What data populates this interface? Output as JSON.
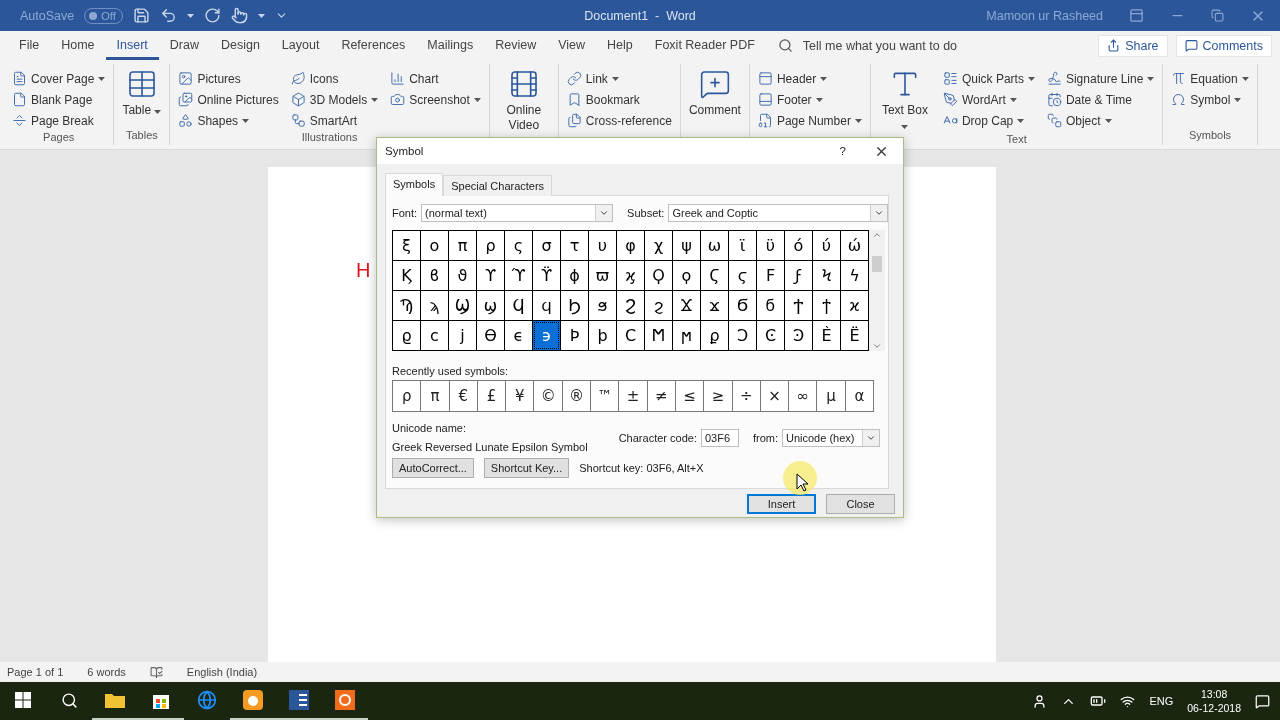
{
  "title_bar": {
    "autosave": {
      "label": "AutoSave",
      "on": false,
      "toggle_text": "Off"
    },
    "title": "Document1  -  Word",
    "user": "Mamoon ur Rasheed"
  },
  "ribbon_tabs": [
    {
      "label": "File",
      "selected": false
    },
    {
      "label": "Home",
      "selected": false
    },
    {
      "label": "Insert",
      "selected": true
    },
    {
      "label": "Draw",
      "selected": false
    },
    {
      "label": "Design",
      "selected": false
    },
    {
      "label": "Layout",
      "selected": false
    },
    {
      "label": "References",
      "selected": false
    },
    {
      "label": "Mailings",
      "selected": false
    },
    {
      "label": "Review",
      "selected": false
    },
    {
      "label": "View",
      "selected": false
    },
    {
      "label": "Help",
      "selected": false
    },
    {
      "label": "Foxit Reader PDF",
      "selected": false
    }
  ],
  "tell_me": {
    "placeholder": "Tell me what you want to do"
  },
  "share_button": "Share",
  "comments_button": "Comments",
  "ribbon_groups": [
    {
      "label": "Pages",
      "columns": [
        {
          "kind": "stack",
          "items": [
            {
              "label": "Cover Page",
              "dropdown": true
            },
            {
              "label": "Blank Page",
              "dropdown": false
            },
            {
              "label": "Page Break",
              "dropdown": false
            }
          ]
        }
      ]
    },
    {
      "label": "Tables",
      "columns": [
        {
          "kind": "large",
          "items": [
            {
              "label": "Table",
              "dropdown": true
            }
          ]
        }
      ]
    },
    {
      "label": "Illustrations",
      "columns": [
        {
          "kind": "stack",
          "items": [
            {
              "label": "Pictures",
              "dropdown": false
            },
            {
              "label": "Online Pictures",
              "dropdown": false
            },
            {
              "label": "Shapes",
              "dropdown": true
            }
          ]
        },
        {
          "kind": "stack",
          "items": [
            {
              "label": "Icons",
              "dropdown": false
            },
            {
              "label": "3D Models",
              "dropdown": true
            },
            {
              "label": "SmartArt",
              "dropdown": false
            }
          ]
        },
        {
          "kind": "stack",
          "items": [
            {
              "label": "Chart",
              "dropdown": false
            },
            {
              "label": "Screenshot",
              "dropdown": true
            }
          ]
        }
      ]
    },
    {
      "columns": [
        {
          "kind": "large",
          "items": [
            {
              "label": "Online Video",
              "dropdown": false
            }
          ]
        }
      ]
    },
    {
      "columns": [
        {
          "kind": "stack",
          "items": [
            {
              "label": "Link",
              "dropdown": true
            },
            {
              "label": "Bookmark",
              "dropdown": false
            },
            {
              "label": "Cross-reference",
              "dropdown": false
            }
          ]
        }
      ]
    },
    {
      "columns": [
        {
          "kind": "large",
          "items": [
            {
              "label": "Comment",
              "dropdown": false
            }
          ]
        }
      ]
    },
    {
      "columns": [
        {
          "kind": "stack",
          "items": [
            {
              "label": "Header",
              "dropdown": true
            },
            {
              "label": "Footer",
              "dropdown": true
            },
            {
              "label": "Page Number",
              "dropdown": true
            }
          ]
        }
      ]
    },
    {
      "label": "Text",
      "columns": [
        {
          "kind": "large",
          "items": [
            {
              "label": "Text Box",
              "dropdown": true
            }
          ]
        },
        {
          "kind": "stack",
          "items": [
            {
              "label": "Quick Parts",
              "dropdown": true
            },
            {
              "label": "WordArt",
              "dropdown": true
            },
            {
              "label": "Drop Cap",
              "dropdown": true
            }
          ]
        },
        {
          "kind": "stack",
          "items": [
            {
              "label": "Signature Line",
              "dropdown": true
            },
            {
              "label": "Date & Time",
              "dropdown": false
            },
            {
              "label": "Object",
              "dropdown": true
            }
          ]
        }
      ]
    },
    {
      "label": "Symbols",
      "columns": [
        {
          "kind": "stack",
          "items": [
            {
              "label": "Equation",
              "dropdown": true
            },
            {
              "label": "Symbol",
              "dropdown": true
            }
          ]
        }
      ]
    }
  ],
  "document": {
    "text": "H"
  },
  "symbol_dialog": {
    "title": "Symbol",
    "help": "?",
    "tabs": [
      {
        "label": "Symbols",
        "selected": true
      },
      {
        "label": "Special Characters",
        "selected": false
      }
    ],
    "font": {
      "label": "Font:",
      "value": "(normal text)"
    },
    "subset": {
      "label": "Subset:",
      "value": "Greek and Coptic"
    },
    "grid": [
      [
        {
          "char": "ξ",
          "selected": false
        },
        {
          "char": "ο",
          "selected": false
        },
        {
          "char": "π",
          "selected": false
        },
        {
          "char": "ρ",
          "selected": false
        },
        {
          "char": "ς",
          "selected": false
        },
        {
          "char": "σ",
          "selected": false
        },
        {
          "char": "τ",
          "selected": false
        },
        {
          "char": "υ",
          "selected": false
        },
        {
          "char": "φ",
          "selected": false
        },
        {
          "char": "χ",
          "selected": false
        },
        {
          "char": "ψ",
          "selected": false
        },
        {
          "char": "ω",
          "selected": false
        },
        {
          "char": "ϊ",
          "selected": false
        },
        {
          "char": "ϋ",
          "selected": false
        },
        {
          "char": "ό",
          "selected": false
        },
        {
          "char": "ύ",
          "selected": false
        },
        {
          "char": "ώ",
          "selected": false
        }
      ],
      [
        {
          "char": "Ϗ",
          "selected": false
        },
        {
          "char": "ϐ",
          "selected": false
        },
        {
          "char": "ϑ",
          "selected": false
        },
        {
          "char": "ϒ",
          "selected": false
        },
        {
          "char": "ϓ",
          "selected": false
        },
        {
          "char": "ϔ",
          "selected": false
        },
        {
          "char": "ϕ",
          "selected": false
        },
        {
          "char": "ϖ",
          "selected": false
        },
        {
          "char": "ϗ",
          "selected": false
        },
        {
          "char": "Ϙ",
          "selected": false
        },
        {
          "char": "ϙ",
          "selected": false
        },
        {
          "char": "Ϛ",
          "selected": false
        },
        {
          "char": "ϛ",
          "selected": false
        },
        {
          "char": "Ϝ",
          "selected": false
        },
        {
          "char": "ϝ",
          "selected": false
        },
        {
          "char": "Ϟ",
          "selected": false
        },
        {
          "char": "ϟ",
          "selected": false
        }
      ],
      [
        {
          "char": "Ϡ",
          "selected": false
        },
        {
          "char": "ϡ",
          "selected": false
        },
        {
          "char": "Ϣ",
          "selected": false
        },
        {
          "char": "ϣ",
          "selected": false
        },
        {
          "char": "Ϥ",
          "selected": false
        },
        {
          "char": "ϥ",
          "selected": false
        },
        {
          "char": "Ϧ",
          "selected": false
        },
        {
          "char": "ϧ",
          "selected": false
        },
        {
          "char": "Ϩ",
          "selected": false
        },
        {
          "char": "ϩ",
          "selected": false
        },
        {
          "char": "Ϫ",
          "selected": false
        },
        {
          "char": "ϫ",
          "selected": false
        },
        {
          "char": "Ϭ",
          "selected": false
        },
        {
          "char": "ϭ",
          "selected": false
        },
        {
          "char": "Ϯ",
          "selected": false
        },
        {
          "char": "ϯ",
          "selected": false
        },
        {
          "char": "ϰ",
          "selected": false
        }
      ],
      [
        {
          "char": "ϱ",
          "selected": false
        },
        {
          "char": "ϲ",
          "selected": false
        },
        {
          "char": "ϳ",
          "selected": false
        },
        {
          "char": "ϴ",
          "selected": false
        },
        {
          "char": "ϵ",
          "selected": false
        },
        {
          "char": "϶",
          "selected": true
        },
        {
          "char": "Ϸ",
          "selected": false
        },
        {
          "char": "ϸ",
          "selected": false
        },
        {
          "char": "Ϲ",
          "selected": false
        },
        {
          "char": "Ϻ",
          "selected": false
        },
        {
          "char": "ϻ",
          "selected": false
        },
        {
          "char": "ϼ",
          "selected": false
        },
        {
          "char": "Ͻ",
          "selected": false
        },
        {
          "char": "Ͼ",
          "selected": false
        },
        {
          "char": "Ͽ",
          "selected": false
        },
        {
          "char": "Ѐ",
          "selected": false
        },
        {
          "char": "Ё",
          "selected": false
        }
      ]
    ],
    "recent_label": "Recently used symbols:",
    "recent": [
      "ρ",
      "π",
      "€",
      "£",
      "¥",
      "©",
      "®",
      "™",
      "±",
      "≠",
      "≤",
      "≥",
      "÷",
      "×",
      "∞",
      "μ",
      "α"
    ],
    "unicode_name_label": "Unicode name:",
    "unicode_name": "Greek Reversed Lunate Epsilon Symbol",
    "character_code": {
      "label": "Character code:",
      "value": "03F6"
    },
    "from": {
      "label": "from:",
      "value": "Unicode (hex)"
    },
    "autocorrect_button": "AutoCorrect...",
    "shortcut_key_button": "Shortcut Key...",
    "shortcut_text": "Shortcut key: 03F6, Alt+X",
    "buttons": [
      {
        "label": "Insert",
        "default": true
      },
      {
        "label": "Close",
        "default": false
      }
    ]
  },
  "status_bar": {
    "page": "Page 1 of 1",
    "words": "6 words",
    "language": "English (India)"
  },
  "taskbar": {
    "apps": [
      {
        "running": true
      },
      {
        "running": true
      },
      {
        "running": false
      },
      {
        "running": true
      },
      {
        "running": true
      },
      {
        "running": true
      }
    ],
    "language": "ENG",
    "time": "13:08",
    "date": "06-12-2018"
  }
}
